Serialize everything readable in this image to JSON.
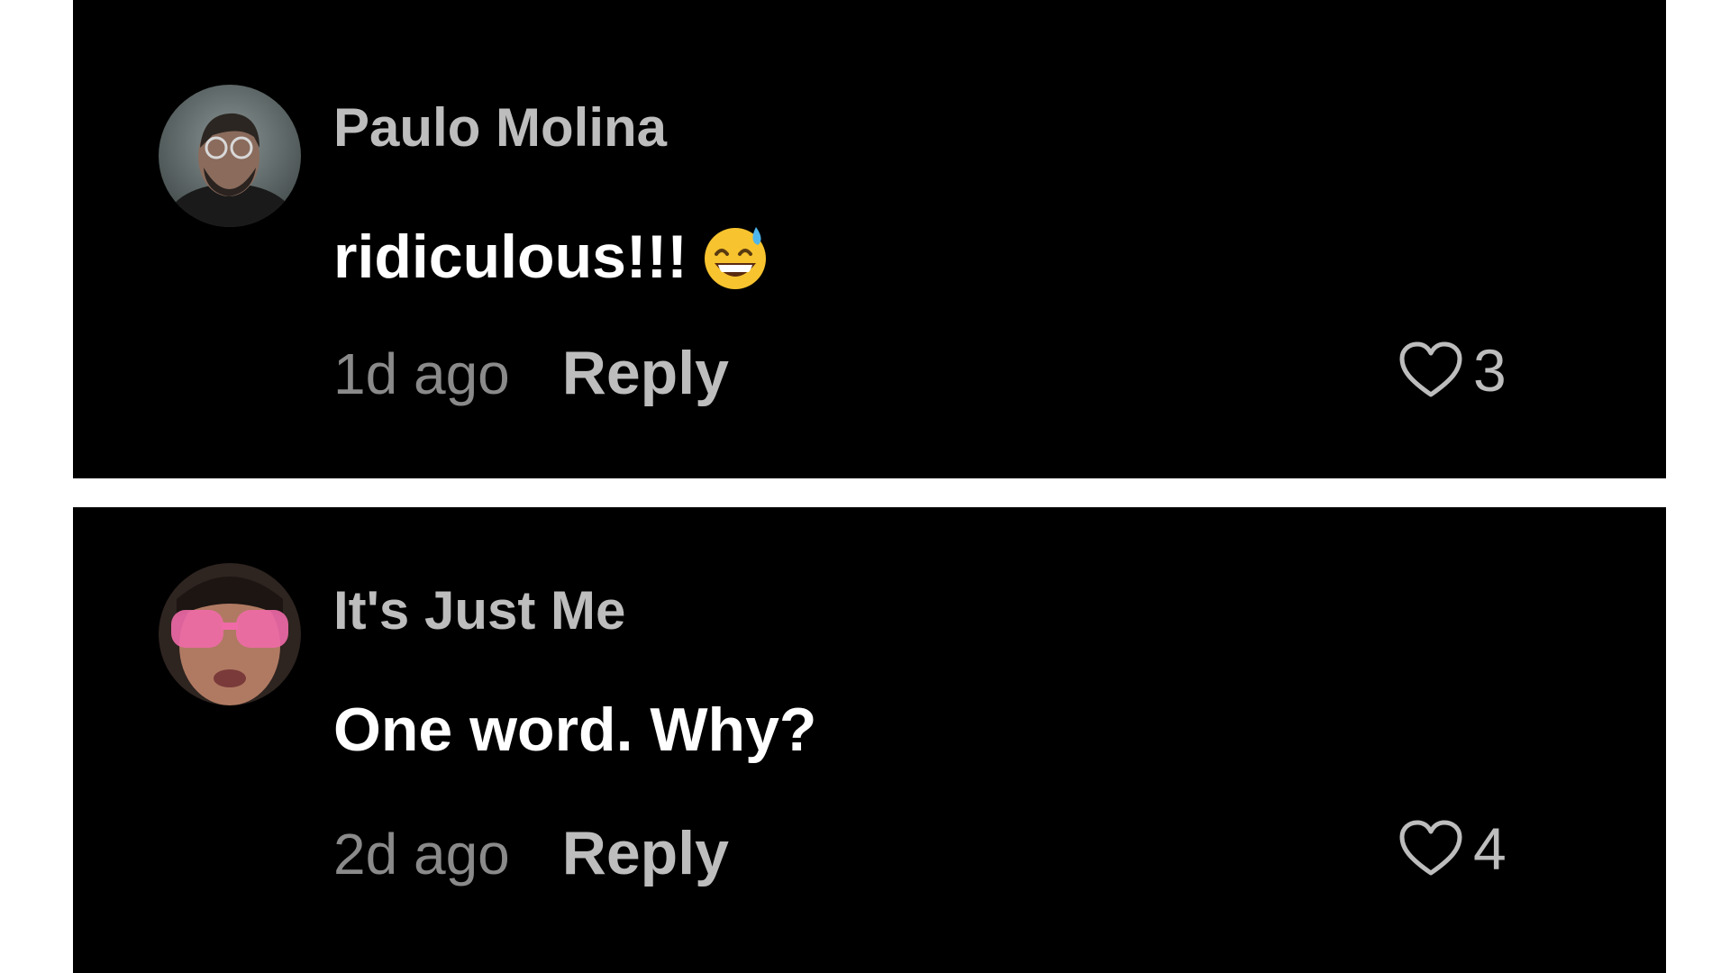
{
  "comments": [
    {
      "username": "Paulo Molina",
      "text": "ridiculous!!!",
      "emoji_icon": "grinning-face-with-sweat-icon",
      "timestamp": "1d ago",
      "reply_label": "Reply",
      "like_count": "3"
    },
    {
      "username": "It's Just Me",
      "text": "One word. Why?",
      "timestamp": "2d ago",
      "reply_label": "Reply",
      "like_count": "4"
    }
  ],
  "colors": {
    "card_background": "#000000",
    "page_background": "#ffffff",
    "username": "#bdbdbd",
    "comment_text": "#ffffff",
    "timestamp": "#8a8a8a",
    "reply": "#bdbdbd",
    "like": "#bdbdbd"
  }
}
